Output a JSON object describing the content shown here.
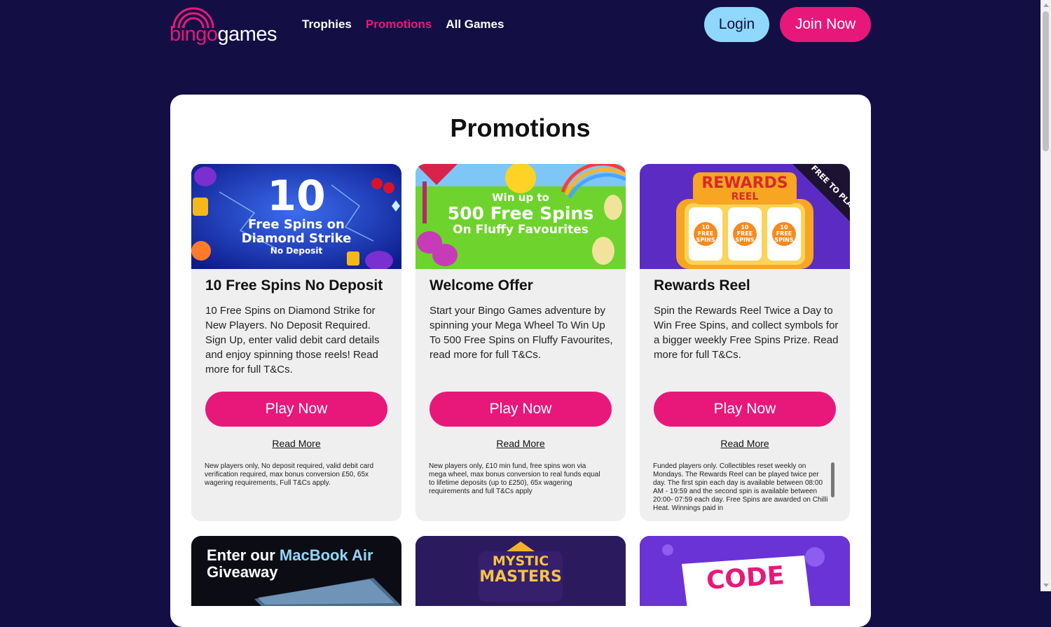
{
  "header": {
    "logo": {
      "part1": "bingo",
      "part2": "games"
    },
    "nav": [
      "Trophies",
      "Promotions",
      "All Games"
    ],
    "login_label": "Login",
    "join_label": "Join Now"
  },
  "page_title": "Promotions",
  "cards": [
    {
      "image": {
        "big": "10",
        "line1": "Free Spins on",
        "line2": "Diamond Strike",
        "line3": "No Deposit"
      },
      "title": "10 Free Spins No Deposit",
      "description": "10 Free Spins on Diamond Strike for New Players. No Deposit Required. Sign Up, enter valid debit card details and enjoy spinning those reels! Read more for full T&Cs.",
      "button": "Play Now",
      "link": "Read More",
      "terms": "New players only, No deposit required, valid debit card verification required, max bonus conversion £50, 65x wagering requirements, Full T&Cs apply."
    },
    {
      "image": {
        "line1": "Win up to",
        "line2": "500 Free Spins",
        "line3": "On Fluffy Favourites"
      },
      "title": "Welcome Offer",
      "description": "Start your Bingo Games adventure by spinning your Mega Wheel To Win Up To 500 Free Spins on Fluffy Favourites, read more for full T&Cs.",
      "button": "Play Now",
      "link": "Read More",
      "terms": "New players only, £10 min fund, free spins won via mega wheel, max bonus conversion to real funds equal to lifetime deposits (up to £250), 65x wagering requirements and full T&Cs apply"
    },
    {
      "image": {
        "title1": "REWARDS",
        "title2": "REEL",
        "ribbon": "FREE TO PLAY",
        "reel": [
          "10",
          "FREE",
          "SPINS"
        ]
      },
      "title": "Rewards Reel",
      "description": "Spin the Rewards Reel Twice a Day to Win Free Spins, and collect symbols for a bigger weekly Free Spins Prize. Read more for full T&Cs.",
      "button": "Play Now",
      "link": "Read More",
      "terms": "Funded players only. Collectibles reset weekly on Mondays. The Rewards Reel can be played twice per day. The first spin each day is available between 08:00 AM - 19:59 and the second spin is available between 20:00- 07:59 each day. Free Spins are awarded on Chilli Heat. Winnings paid in"
    }
  ],
  "second_row": [
    {
      "line1a": "Enter our ",
      "line1b": "MacBook Air",
      "line2": "Giveaway"
    },
    {
      "line1": "MYSTIC",
      "line2": "MASTERS"
    },
    {
      "line1": "CODE"
    }
  ],
  "colors": {
    "background": "#130f44",
    "accent": "#e8187b",
    "login": "#8fd8fb",
    "card": "#efefef"
  }
}
